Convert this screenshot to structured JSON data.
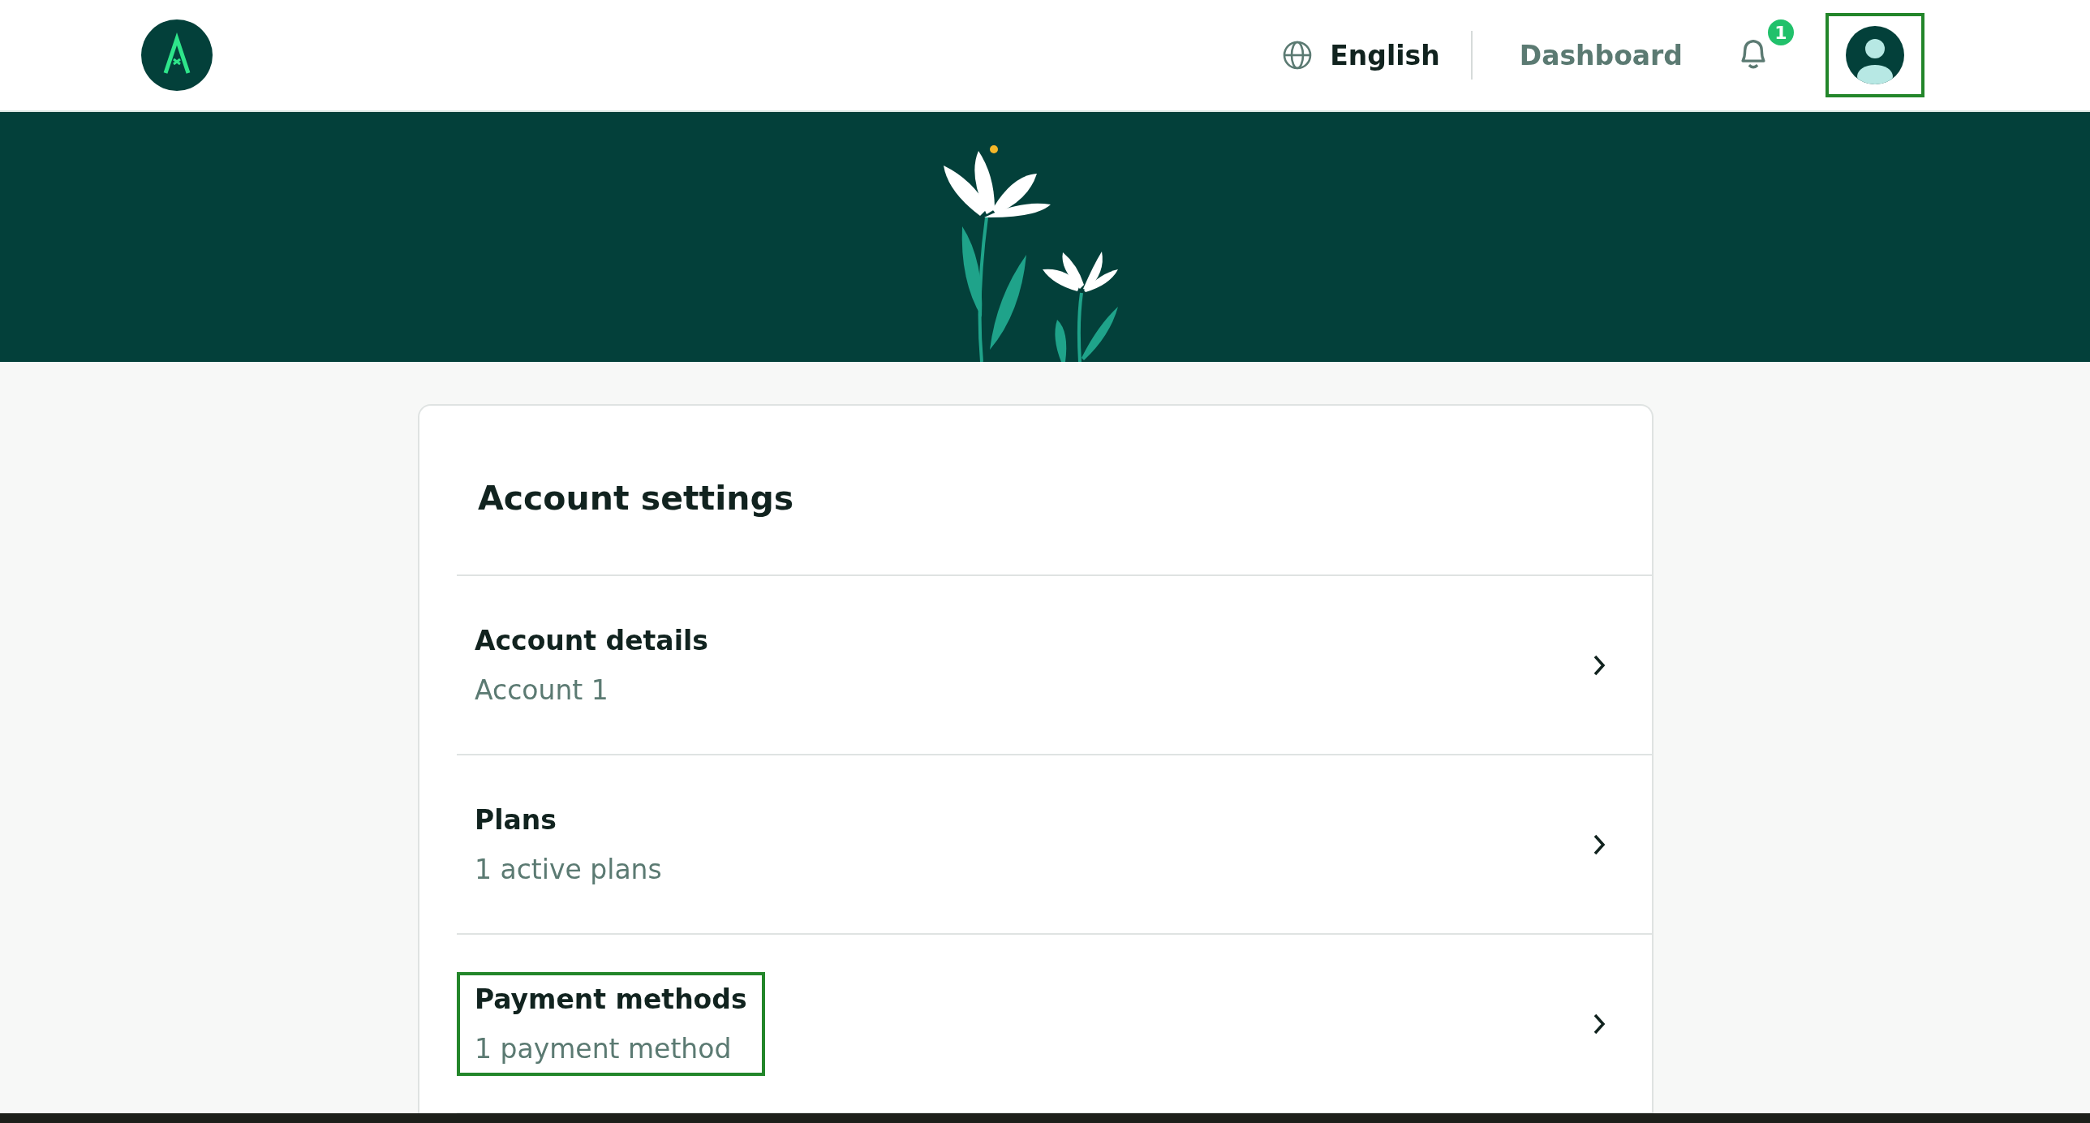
{
  "header": {
    "language": "English",
    "nav_link": "Dashboard",
    "notifications": {
      "count": "1"
    },
    "profile": {
      "highlighted": true
    }
  },
  "card": {
    "title": "Account settings",
    "items": [
      {
        "title": "Account details",
        "subtitle": "Account 1",
        "highlighted": false
      },
      {
        "title": "Plans",
        "subtitle": "1 active plans",
        "highlighted": false
      },
      {
        "title": "Payment methods",
        "subtitle": "1 payment method",
        "highlighted": true
      }
    ]
  }
}
